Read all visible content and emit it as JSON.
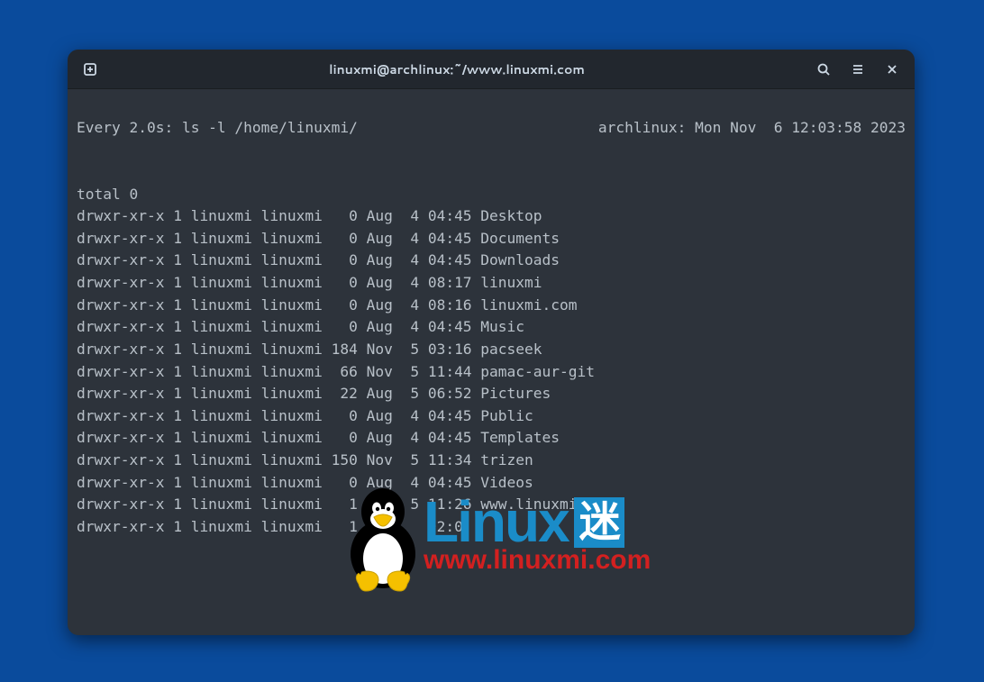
{
  "titlebar": {
    "title": "linuxmi@archlinux:~/www.linuxmi.com"
  },
  "watch": {
    "interval_label": "Every 2.0s: ls -l /home/linuxmi/",
    "host_time": "archlinux: Mon Nov  6 12:03:58 2023"
  },
  "listing": {
    "total_line": "total 0",
    "rows": [
      {
        "perm": "drwxr-xr-x",
        "links": "1",
        "owner": "linuxmi",
        "group": "linuxmi",
        "size": "0",
        "month": "Aug",
        "day": "4",
        "time": "04:45",
        "name": "Desktop"
      },
      {
        "perm": "drwxr-xr-x",
        "links": "1",
        "owner": "linuxmi",
        "group": "linuxmi",
        "size": "0",
        "month": "Aug",
        "day": "4",
        "time": "04:45",
        "name": "Documents"
      },
      {
        "perm": "drwxr-xr-x",
        "links": "1",
        "owner": "linuxmi",
        "group": "linuxmi",
        "size": "0",
        "month": "Aug",
        "day": "4",
        "time": "04:45",
        "name": "Downloads"
      },
      {
        "perm": "drwxr-xr-x",
        "links": "1",
        "owner": "linuxmi",
        "group": "linuxmi",
        "size": "0",
        "month": "Aug",
        "day": "4",
        "time": "08:17",
        "name": "linuxmi"
      },
      {
        "perm": "drwxr-xr-x",
        "links": "1",
        "owner": "linuxmi",
        "group": "linuxmi",
        "size": "0",
        "month": "Aug",
        "day": "4",
        "time": "08:16",
        "name": "linuxmi.com"
      },
      {
        "perm": "drwxr-xr-x",
        "links": "1",
        "owner": "linuxmi",
        "group": "linuxmi",
        "size": "0",
        "month": "Aug",
        "day": "4",
        "time": "04:45",
        "name": "Music"
      },
      {
        "perm": "drwxr-xr-x",
        "links": "1",
        "owner": "linuxmi",
        "group": "linuxmi",
        "size": "184",
        "month": "Nov",
        "day": "5",
        "time": "03:16",
        "name": "pacseek"
      },
      {
        "perm": "drwxr-xr-x",
        "links": "1",
        "owner": "linuxmi",
        "group": "linuxmi",
        "size": "66",
        "month": "Nov",
        "day": "5",
        "time": "11:44",
        "name": "pamac-aur-git"
      },
      {
        "perm": "drwxr-xr-x",
        "links": "1",
        "owner": "linuxmi",
        "group": "linuxmi",
        "size": "22",
        "month": "Aug",
        "day": "5",
        "time": "06:52",
        "name": "Pictures"
      },
      {
        "perm": "drwxr-xr-x",
        "links": "1",
        "owner": "linuxmi",
        "group": "linuxmi",
        "size": "0",
        "month": "Aug",
        "day": "4",
        "time": "04:45",
        "name": "Public"
      },
      {
        "perm": "drwxr-xr-x",
        "links": "1",
        "owner": "linuxmi",
        "group": "linuxmi",
        "size": "0",
        "month": "Aug",
        "day": "4",
        "time": "04:45",
        "name": "Templates"
      },
      {
        "perm": "drwxr-xr-x",
        "links": "1",
        "owner": "linuxmi",
        "group": "linuxmi",
        "size": "150",
        "month": "Nov",
        "day": "5",
        "time": "11:34",
        "name": "trizen"
      },
      {
        "perm": "drwxr-xr-x",
        "links": "1",
        "owner": "linuxmi",
        "group": "linuxmi",
        "size": "0",
        "month": "Aug",
        "day": "4",
        "time": "04:45",
        "name": "Videos"
      },
      {
        "perm": "drwxr-xr-x",
        "links": "1",
        "owner": "linuxmi",
        "group": "linuxmi",
        "size": "1",
        "month": "Nov",
        "day": "5",
        "time": "11:26",
        "name": "www.linuxmi.com"
      },
      {
        "perm": "drwxr-xr-x",
        "links": "1",
        "owner": "linuxmi",
        "group": "linuxmi",
        "size": "1",
        "month": "Nov",
        "day": "",
        "time": "02:0",
        "name": ""
      }
    ]
  },
  "watermark": {
    "brand": "Linux",
    "suffix": "迷",
    "url": "www.linuxmi.com"
  }
}
